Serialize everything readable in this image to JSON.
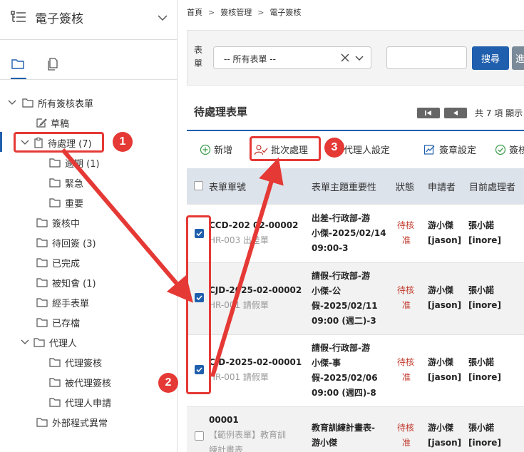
{
  "sidebar": {
    "title": "電子簽核",
    "tree": {
      "root": "所有簽核表單",
      "items": {
        "draft": "草稿",
        "pending": "待處理 (7)",
        "overdue": "逾期 (1)",
        "urgent": "緊急",
        "important": "重要",
        "signing": "簽核中",
        "to_return": "待回簽 (3)",
        "completed": "已完成",
        "notified": "被知會 (1)",
        "handled": "經手表單",
        "archived": "已存檔",
        "proxy": "代理人",
        "proxy_sign": "代理簽核",
        "proxied_sign": "被代理簽核",
        "proxy_apply": "代理人申請",
        "external_error": "外部程式異常"
      }
    }
  },
  "breadcrumb": [
    "首頁",
    "簽核管理",
    "電子簽核"
  ],
  "filter": {
    "label": "表單",
    "select_value": "-- 所有表單 --",
    "search_button": "搜尋",
    "more_button": "進"
  },
  "section": {
    "title": "待處理表單",
    "pager_text": "共 7 項 顯示"
  },
  "toolbar": {
    "add": "新增",
    "batch": "批次處理",
    "proxy_setting": "代理人設定",
    "seal_setting": "簽章設定",
    "sign": "簽核"
  },
  "table": {
    "headers": {
      "form_no": "表單單號",
      "subject": "表單主題重要性",
      "status": "狀態",
      "applicant": "申請者",
      "handler": "目前處理者"
    },
    "rows": [
      {
        "no": "CCD-202 02-00002",
        "form": "HR-003 出差單",
        "subject": [
          "出差-行政部-游",
          "小傑-2025/02/14",
          "09:00-3"
        ],
        "status": [
          "待核",
          "准"
        ],
        "applicant": [
          "游小傑",
          "[jason]"
        ],
        "handler": [
          "張小諾",
          "[inore]"
        ]
      },
      {
        "no": "CJD-2025-02-00002",
        "form": "HR-001 請假單",
        "subject": [
          "請假-行政部-游",
          "小傑-公",
          "假-2025/02/11",
          "09:00 (週二)-3"
        ],
        "status": [
          "待核",
          "准"
        ],
        "applicant": [
          "游小傑",
          "[jason]"
        ],
        "handler": [
          "張小諾",
          "[inore]"
        ]
      },
      {
        "no": "CJD-2025-02-00001",
        "form": "HR-001 請假單",
        "subject": [
          "請假-行政部-游",
          "小傑-事",
          "假-2025/02/06",
          "09:00 (週四)-8"
        ],
        "status": [
          "待核",
          "准"
        ],
        "applicant": [
          "游小傑",
          "[jason]"
        ],
        "handler": [
          "張小諾",
          "[inore]"
        ]
      },
      {
        "no": "00001",
        "form": [
          "【範例表單】教育訓",
          "練計畫表"
        ],
        "subject": [
          "教育訓練計畫表-",
          "游小傑"
        ],
        "status": [
          "待核",
          "准"
        ],
        "applicant": [
          "游小傑",
          "[jason]"
        ],
        "handler": [
          "張小諾",
          "[inore]"
        ]
      }
    ]
  },
  "annotations": [
    "1",
    "2",
    "3"
  ],
  "colors": {
    "primary": "#1f5fad",
    "annotation_red": "#e53935",
    "status_red": "#c0392b"
  }
}
